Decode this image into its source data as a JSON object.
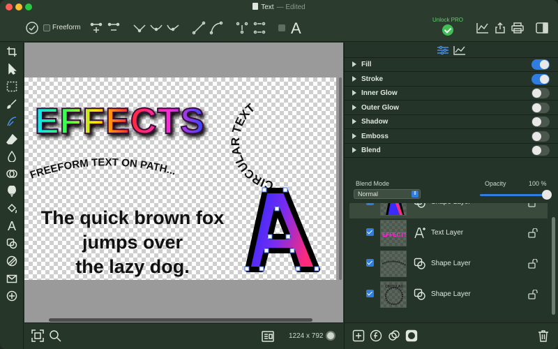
{
  "window": {
    "title": "Text",
    "title_suffix": "— Edited"
  },
  "toolbar": {
    "freeform_label": "Freeform",
    "text_tool_glyph": "A",
    "unlock_label": "Unlock PRO",
    "icons": [
      "checkmark-circle-icon",
      "add-node-icon",
      "curve-node-icons",
      "line-node-icons",
      "distribute-icons",
      "text-tool-icon",
      "chart-icon",
      "share-icon",
      "print-icon",
      "sidebar-icon"
    ]
  },
  "canvas": {
    "effects_text": "EFFECTS",
    "circular_text": "CIRCULAR TEXT",
    "path_text": "FREEFORM TEXT ON PATH...",
    "body_line1": "The quick brown fox",
    "body_line2": "jumps over",
    "body_line3": "the lazy dog.",
    "big_letter": "A",
    "document_size": "1224 x 792"
  },
  "effects": [
    {
      "label": "Fill",
      "on": true
    },
    {
      "label": "Stroke",
      "on": true
    },
    {
      "label": "Inner Glow",
      "on": false
    },
    {
      "label": "Outer Glow",
      "on": false
    },
    {
      "label": "Shadow",
      "on": false
    },
    {
      "label": "Emboss",
      "on": false
    },
    {
      "label": "Blend",
      "on": false
    }
  ],
  "blend": {
    "mode_label": "Blend Mode",
    "mode_value": "Normal",
    "opacity_label": "Opacity",
    "opacity_value": "100 %",
    "opacity": 1.0
  },
  "layers": [
    {
      "name": "Shape Layer",
      "visible": true,
      "type": "shape"
    },
    {
      "name": "Text Layer",
      "visible": true,
      "type": "text"
    },
    {
      "name": "Shape Layer",
      "visible": true,
      "type": "shape"
    },
    {
      "name": "Shape Layer",
      "visible": true,
      "type": "shape"
    }
  ],
  "thumbs": {
    "effects_text": "EFFECTS",
    "circular_text": "CIRCULAR"
  },
  "colors": {
    "accent": "#2f7de0",
    "pro_green": "#3fbf55"
  }
}
